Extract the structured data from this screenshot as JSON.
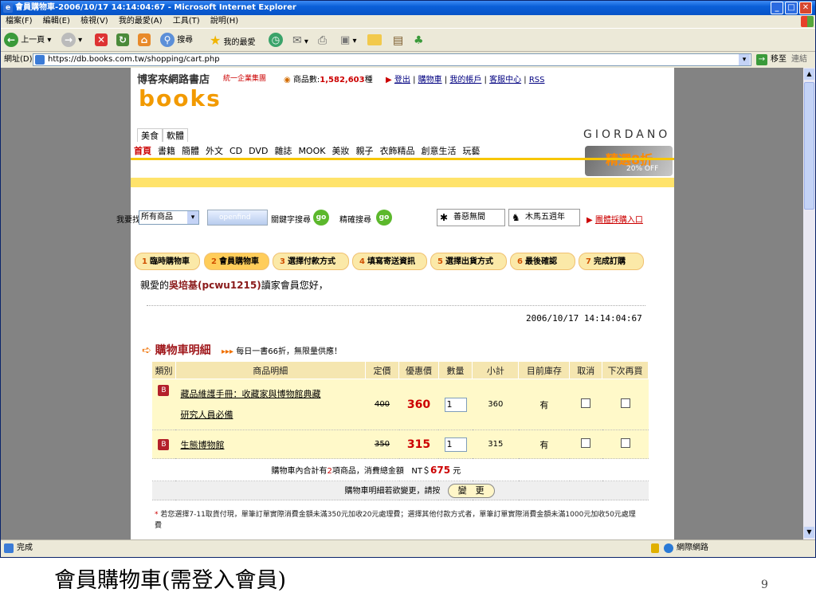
{
  "window": {
    "title": "會員購物車-2006/10/17 14:14:04:67 - Microsoft Internet Explorer"
  },
  "menu": [
    "檔案(F)",
    "編輯(E)",
    "檢視(V)",
    "我的最愛(A)",
    "工具(T)",
    "說明(H)"
  ],
  "toolbar": {
    "back": "上一頁",
    "search": "搜尋",
    "favorites": "我的最愛"
  },
  "address": {
    "label": "網址(D)",
    "url": "https://db.books.com.tw/shopping/cart.php",
    "go": "移至",
    "links": "連結"
  },
  "site": {
    "brand_cn": "博客來網路書店",
    "brand_sub": "統一企業集團",
    "logo": "books",
    "goods_count_label": "商品數:",
    "goods_count": "1,582,603",
    "goods_unit": "種",
    "top_links": [
      "登出",
      "購物車",
      "我的帳戶",
      "客服中心",
      "RSS"
    ],
    "ad_brand": "GIORDANO",
    "ad_text": "精選8折",
    "ad_sub": "20% OFF",
    "sub_tabs": [
      "美食",
      "軟體"
    ],
    "main_tabs": [
      "首頁",
      "書籍",
      "簡體",
      "外文",
      "CD",
      "DVD",
      "雜誌",
      "MOOK",
      "美妝",
      "親子",
      "衣飾精品",
      "創意生活",
      "玩藝"
    ]
  },
  "search": {
    "label": "我要找",
    "scope": "所有商品",
    "engine": "openfind",
    "keyword_btn": "關鍵字搜尋",
    "go": "go",
    "precise": "精確搜尋",
    "banner1": "善惡無間",
    "banner2": "木馬五週年",
    "group_buy": "團體採購入口"
  },
  "steps": [
    {
      "num": "1",
      "label": "臨時購物車"
    },
    {
      "num": "2",
      "label": "會員購物車"
    },
    {
      "num": "3",
      "label": "選擇付款方式"
    },
    {
      "num": "4",
      "label": "填寫寄送資訊"
    },
    {
      "num": "5",
      "label": "選擇出貨方式"
    },
    {
      "num": "6",
      "label": "最後確認"
    },
    {
      "num": "7",
      "label": "完成訂購"
    }
  ],
  "greeting": {
    "prefix": "親愛的",
    "name": "吳培基(pcwu1215)",
    "suffix": "讀家會員您好，"
  },
  "timestamp": "2006/10/17 14:14:04:67",
  "cart": {
    "title": "購物車明細",
    "promo": "每日一書66折，無限量供應！",
    "headers": [
      "類別",
      "商品明細",
      "定價",
      "優惠價",
      "數量",
      "小計",
      "目前庫存",
      "取消",
      "下次再買"
    ],
    "rows": [
      {
        "name_line1": "藏品維護手冊：收藏家與博物館典藏",
        "name_line2": "研究人員必備",
        "list": "400",
        "sale": "360",
        "qty": "1",
        "subtotal": "360",
        "stock": "有"
      },
      {
        "name_line1": "生態博物館",
        "name_line2": "",
        "list": "350",
        "sale": "315",
        "qty": "1",
        "subtotal": "315",
        "stock": "有"
      }
    ],
    "summary_prefix": "購物車內合計有",
    "summary_count": "2",
    "summary_mid": "項商品，消費總金額",
    "summary_currency": "NT＄",
    "summary_total": "675",
    "summary_unit": "元",
    "change_text": "購物車明細若欲變更，請按",
    "change_btn": "變　更",
    "note": "若您選擇7-11取貨付現，單筆訂單實際消費金額未滿350元加收20元處理費；選擇其他付款方式者，單筆訂單實際消費金額未滿1000元加收50元處理費"
  },
  "status": {
    "left": "完成",
    "zone": "網際網路"
  },
  "caption": "會員購物車(需登入會員)",
  "slide_number": "9"
}
